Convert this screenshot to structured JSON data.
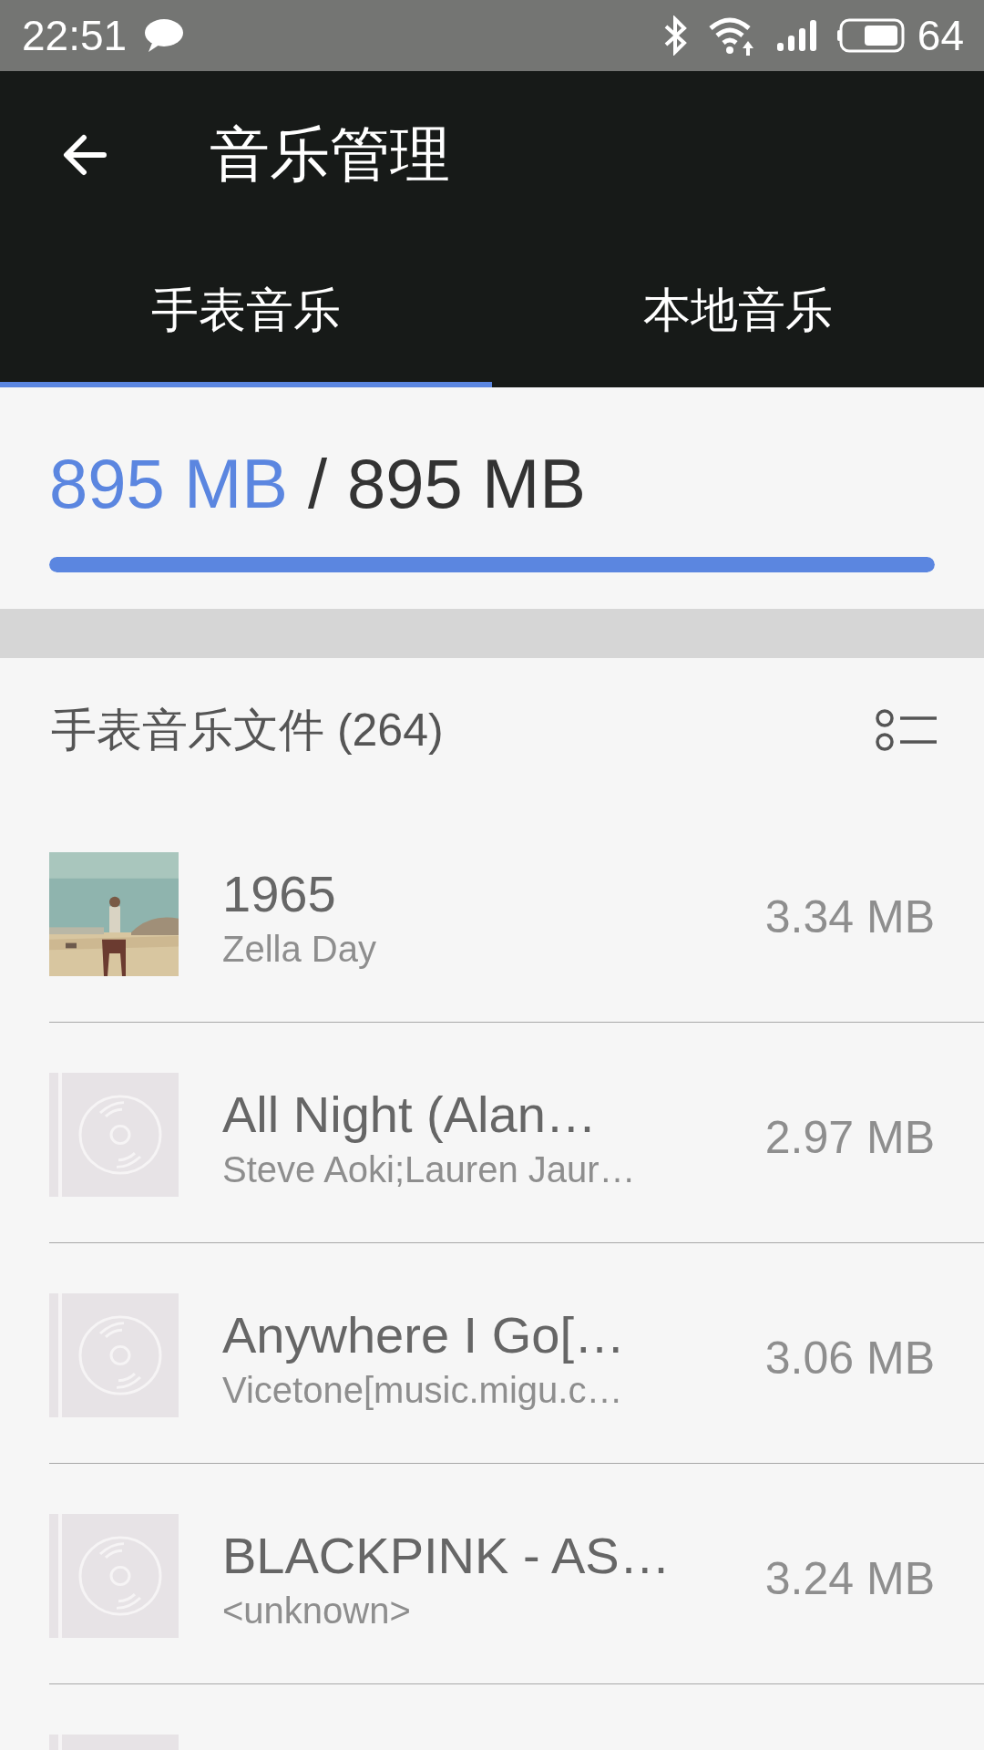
{
  "status_bar": {
    "time": "22:51",
    "battery": "64"
  },
  "app_bar": {
    "title": "音乐管理"
  },
  "tabs": [
    {
      "label": "手表音乐",
      "selected": true
    },
    {
      "label": "本地音乐",
      "selected": false
    }
  ],
  "storage": {
    "used": "895 MB",
    "separator": "/",
    "total": "895 MB",
    "level": 1
  },
  "list_header": {
    "title": "手表音乐文件 (264)"
  },
  "songs": [
    {
      "kind": "picture",
      "title": "1965",
      "artist": "Zella Day",
      "size": "3.34 MB"
    },
    {
      "kind": "disc",
      "title": "All Night (Alan…",
      "artist": "Steve Aoki;Lauren Jaur…",
      "size": "2.97 MB"
    },
    {
      "kind": "disc",
      "title": "Anywhere I Go[…",
      "artist": "Vicetone[music.migu.c…",
      "size": "3.06 MB"
    },
    {
      "kind": "disc",
      "title": "BLACKPINK - AS…",
      "artist": "<unknown>",
      "size": "3.24 MB"
    },
    {
      "kind": "disc"
    }
  ]
}
